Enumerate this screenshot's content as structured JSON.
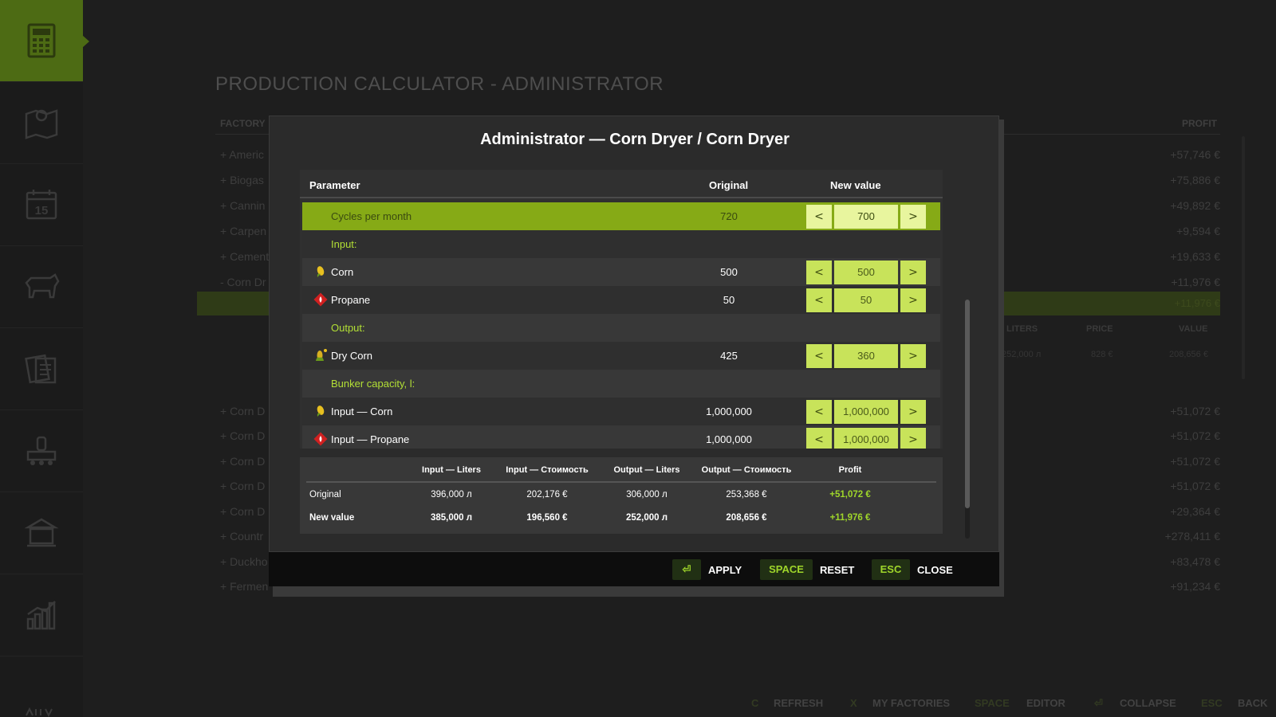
{
  "sidebar": {
    "items": [
      {
        "icon": "calculator-icon",
        "active": true
      },
      {
        "icon": "map-icon"
      },
      {
        "icon": "calendar-icon",
        "label": "15"
      },
      {
        "icon": "cow-icon"
      },
      {
        "icon": "contracts-icon"
      },
      {
        "icon": "production-icon"
      },
      {
        "icon": "bank-icon"
      },
      {
        "icon": "statistics-icon"
      },
      {
        "icon": "more-icon"
      }
    ]
  },
  "page": {
    "title": "PRODUCTION CALCULATOR - ADMINISTRATOR",
    "col_factory": "FACTORY",
    "col_profit": "PROFIT",
    "rows": [
      {
        "name": "+ Americ",
        "profit": "+57,746 €"
      },
      {
        "name": "+ Biogas",
        "profit": "+75,886 €"
      },
      {
        "name": "+ Cannin",
        "profit": "+49,892 €"
      },
      {
        "name": "+ Carpen",
        "profit": "+9,594 €"
      },
      {
        "name": "+ Cement",
        "profit": "+19,633 €"
      },
      {
        "name": "- Corn Dr",
        "profit": "+11,976 €"
      }
    ],
    "highlight_row_profit": "+11,976 €",
    "sub_headers": {
      "liters": "LITERS",
      "price": "PRICE",
      "value": "VALUE"
    },
    "sub_values": {
      "liters": "252,000 л",
      "price": "828 €",
      "value": "208,656 €"
    },
    "rows2": [
      {
        "name": "+ Corn D",
        "profit": "+51,072 €"
      },
      {
        "name": "+ Corn D",
        "profit": "+51,072 €"
      },
      {
        "name": "+ Corn D",
        "profit": "+51,072 €"
      },
      {
        "name": "+ Corn D",
        "profit": "+51,072 €"
      },
      {
        "name": "+ Corn D",
        "profit": "+29,364 €"
      },
      {
        "name": "+ Countr",
        "profit": "+278,411 €"
      },
      {
        "name": "+ Duckho",
        "profit": "+83,478 €"
      },
      {
        "name": "+ Fermen",
        "profit": "+91,234 €"
      }
    ]
  },
  "bottom_hints": [
    {
      "key": "C",
      "label": "REFRESH"
    },
    {
      "key": "X",
      "label": "MY FACTORIES"
    },
    {
      "key": "SPACE",
      "label": "EDITOR"
    },
    {
      "key": "⏎",
      "label": "COLLAPSE"
    },
    {
      "key": "ESC",
      "label": "BACK"
    }
  ],
  "dialog": {
    "title": "Administrator — Corn Dryer / Corn Dryer",
    "headers": {
      "parameter": "Parameter",
      "original": "Original",
      "new_value": "New value"
    },
    "rows": [
      {
        "label": "Cycles per month",
        "original": "720",
        "value": "700",
        "selected": true
      },
      {
        "label": "Input:",
        "section": true
      },
      {
        "label": "Corn",
        "original": "500",
        "value": "500",
        "icon": "corn-icon"
      },
      {
        "label": "Propane",
        "original": "50",
        "value": "50",
        "icon": "propane-icon"
      },
      {
        "label": "Output:",
        "section": true
      },
      {
        "label": "Dry Corn",
        "original": "425",
        "value": "360",
        "icon": "dry-corn-icon"
      },
      {
        "label": "Bunker capacity, l:",
        "section": true
      },
      {
        "label": "Input — Corn",
        "original": "1,000,000",
        "value": "1,000,000",
        "icon": "corn-icon"
      },
      {
        "label": "Input — Propane",
        "original": "1,000,000",
        "value": "1,000,000",
        "icon": "propane-icon"
      }
    ],
    "stepper": {
      "dec": "<",
      "inc": ">"
    },
    "summary": {
      "headers": [
        "Input — Liters",
        "Input — Стоимость",
        "Output — Liters",
        "Output — Стоимость",
        "Profit"
      ],
      "rows": [
        {
          "label": "Original",
          "values": [
            "396,000 л",
            "202,176 €",
            "306,000 л",
            "253,368 €",
            "+51,072 €"
          ]
        },
        {
          "label": "New value",
          "values": [
            "385,000 л",
            "196,560 €",
            "252,000 л",
            "208,656 €",
            "+11,976 €"
          ]
        }
      ]
    },
    "footer": {
      "apply_key": "⏎",
      "apply_label": "APPLY",
      "reset_key": "SPACE",
      "reset_label": "RESET",
      "close_key": "ESC",
      "close_label": "CLOSE"
    }
  },
  "colors": {
    "accent": "#86aa16",
    "stepper": "#c8e35a",
    "profit_green": "#9fd62a",
    "section_text": "#b3e035"
  }
}
